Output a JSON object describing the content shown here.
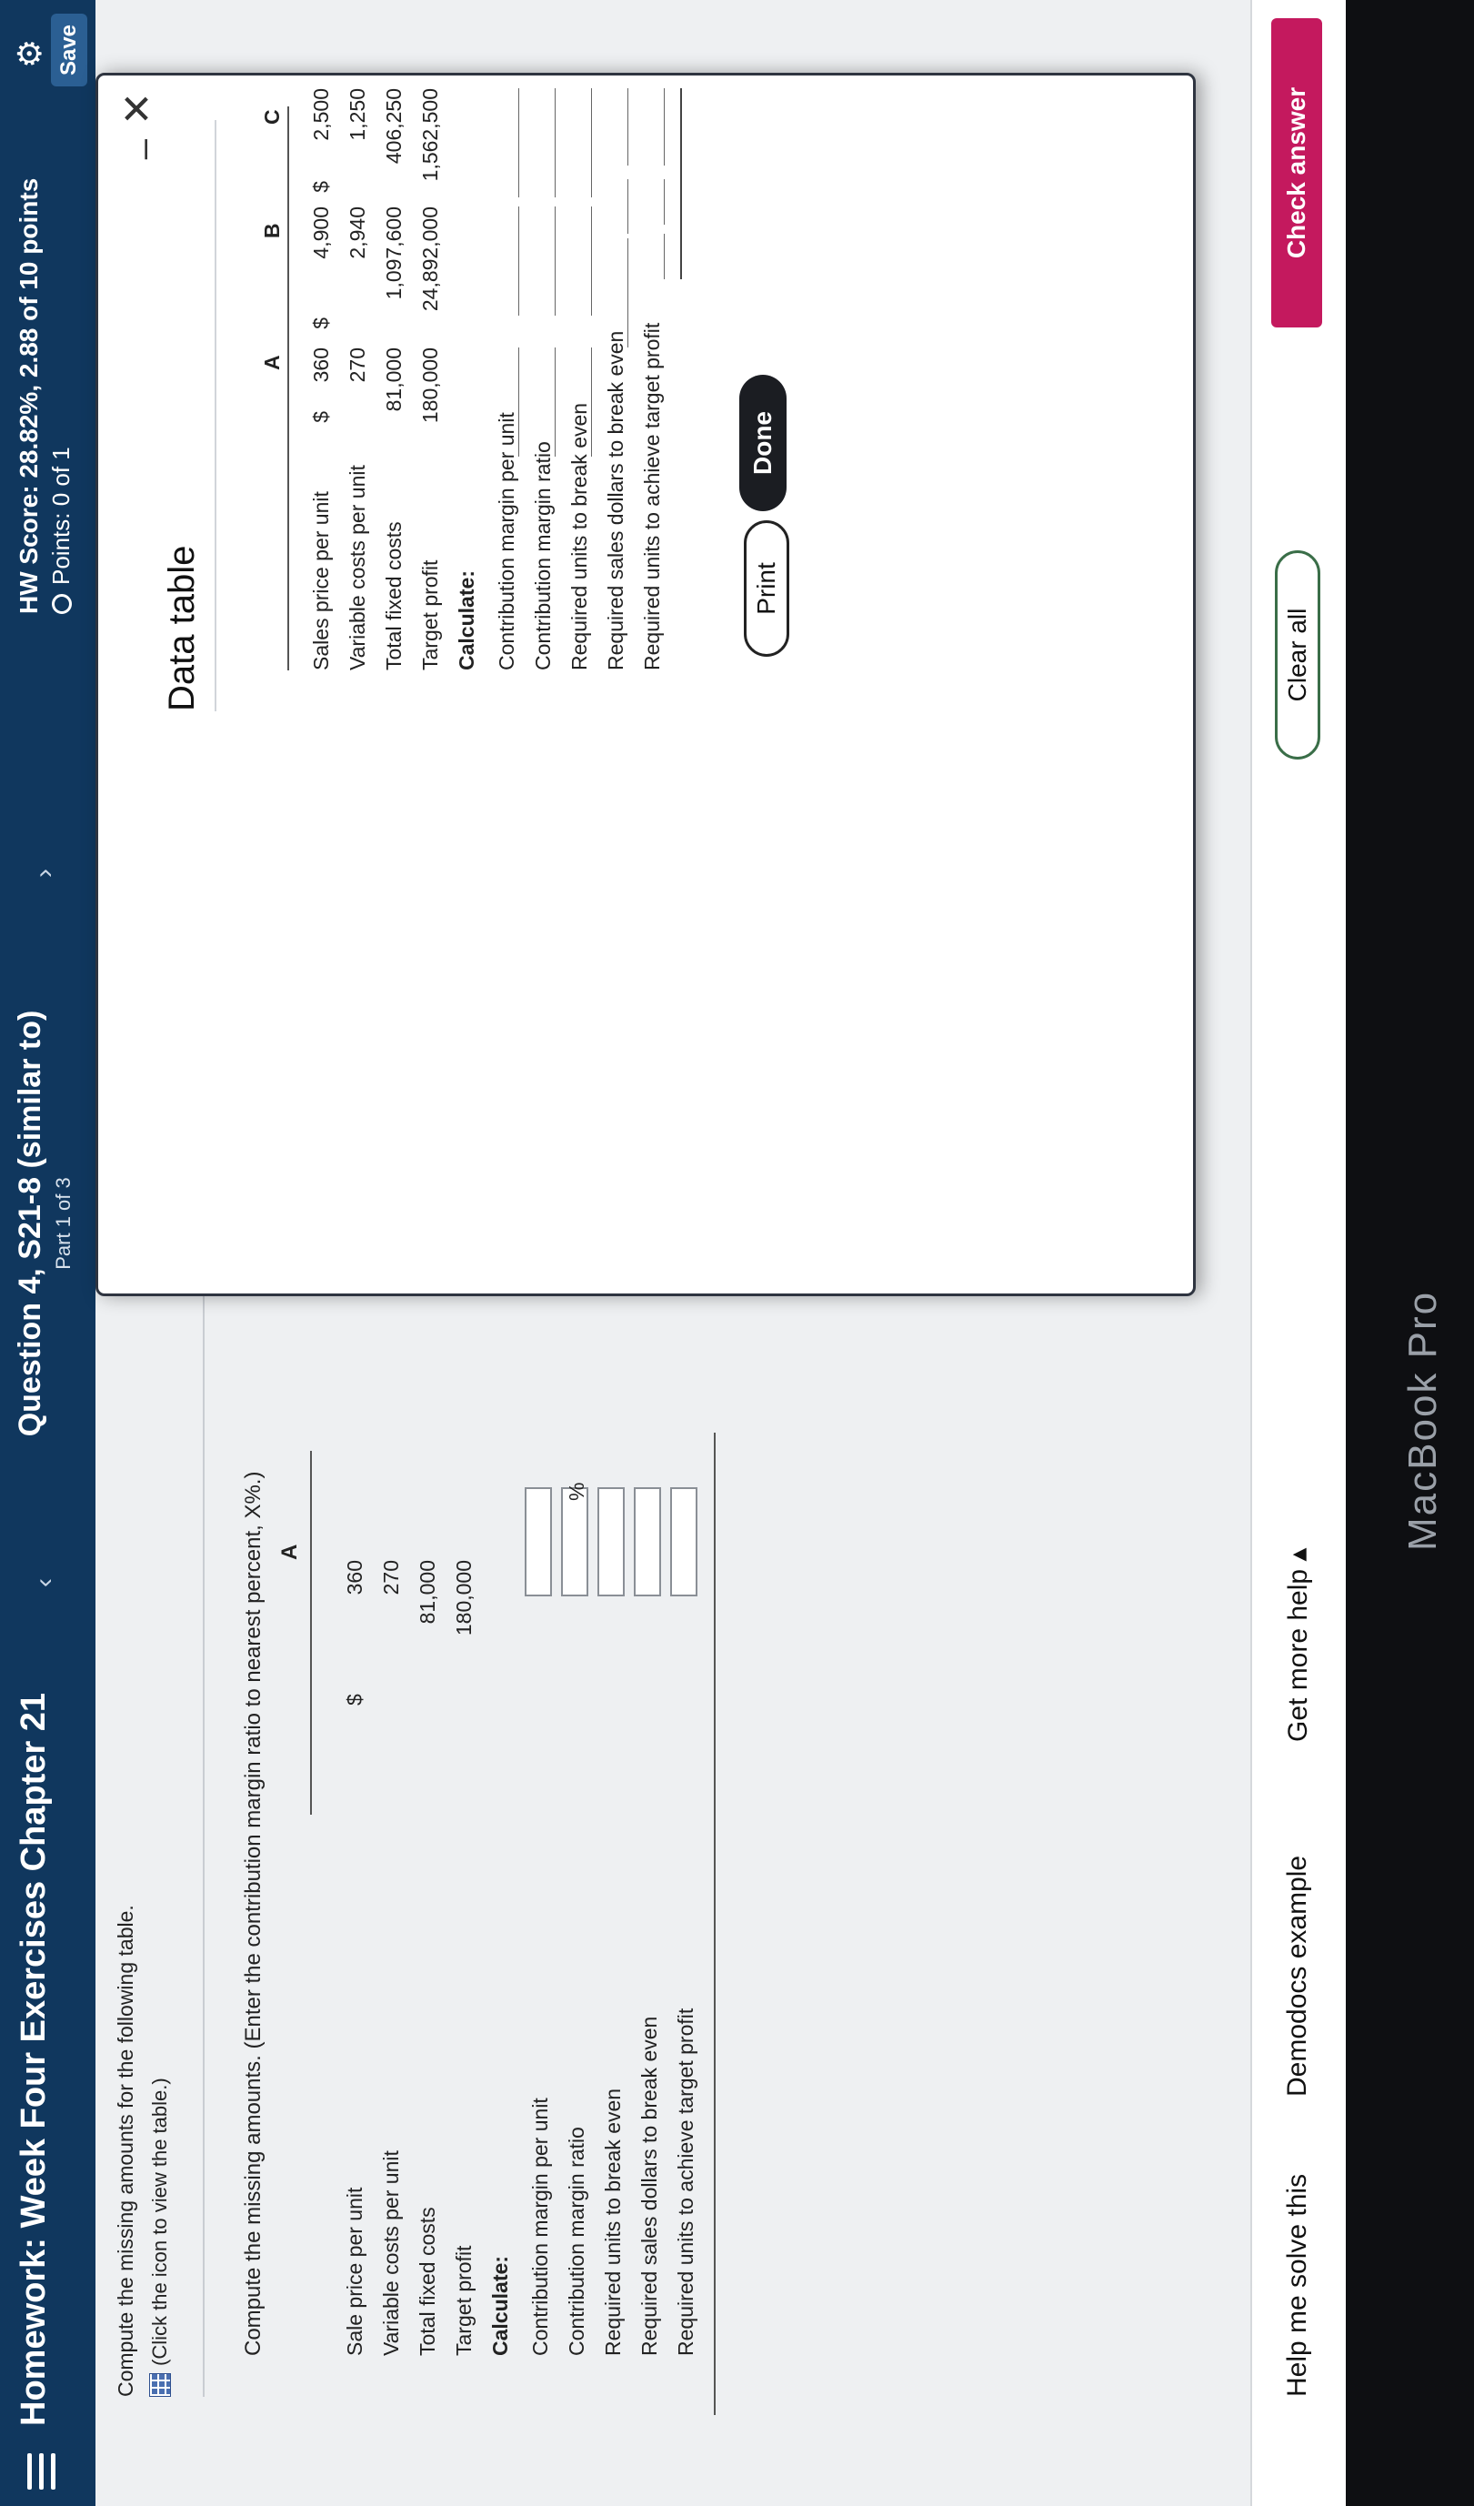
{
  "header": {
    "hw_title": "Homework: Week Four Exercises Chapter 21",
    "question_title": "Question 4, S21-8 (similar to)",
    "part": "Part 1 of 3",
    "prev_glyph": "‹",
    "next_glyph": "›",
    "hw_score": "HW Score: 28.82%, 2.88 of 10 points",
    "points": "Points: 0 of 1",
    "save_label": "Save",
    "gear_glyph": "⚙"
  },
  "main": {
    "instruction": "Compute the missing amounts for the following table.",
    "table_link": "(Click the icon to view the table.)",
    "compute_line": "Compute the missing amounts. (Enter the contribution margin ratio to nearest percent, X%.)",
    "column_header": "A",
    "dollar_sign": "$",
    "pct_sign": "%",
    "rows": [
      {
        "label": "Sale price per unit",
        "value": "360"
      },
      {
        "label": "Variable costs per unit",
        "value": "270"
      },
      {
        "label": "Total fixed costs",
        "value": "81,000"
      },
      {
        "label": "Target profit",
        "value": "180,000"
      },
      {
        "label": "Calculate:",
        "value": ""
      },
      {
        "label": "Contribution margin per unit",
        "value": ""
      },
      {
        "label": "Contribution margin ratio",
        "value": ""
      },
      {
        "label": "Required units to break even",
        "value": ""
      },
      {
        "label": "Required sales dollars to break even",
        "value": ""
      },
      {
        "label": "Required units to achieve target profit",
        "value": ""
      }
    ]
  },
  "modal": {
    "title": "Data table",
    "minimize_glyph": "–",
    "close_glyph": "✕",
    "columns": [
      "A",
      "B",
      "C"
    ],
    "dollar_sign": "$",
    "rows": [
      {
        "label": "Sales price per unit",
        "a": "360",
        "b": "4,900",
        "c": "2,500"
      },
      {
        "label": "Variable costs per unit",
        "a": "270",
        "b": "2,940",
        "c": "1,250"
      },
      {
        "label": "Total fixed costs",
        "a": "81,000",
        "b": "1,097,600",
        "c": "406,250"
      },
      {
        "label": "Target profit",
        "a": "180,000",
        "b": "24,892,000",
        "c": "1,562,500"
      },
      {
        "label": "Calculate:",
        "a": "",
        "b": "",
        "c": ""
      },
      {
        "label": "Contribution margin per unit",
        "a": "",
        "b": "",
        "c": ""
      },
      {
        "label": "Contribution margin ratio",
        "a": "",
        "b": "",
        "c": ""
      },
      {
        "label": "Required units to break even",
        "a": "",
        "b": "",
        "c": ""
      },
      {
        "label": "Required sales dollars to break even",
        "a": "",
        "b": "",
        "c": ""
      },
      {
        "label": "Required units to achieve target profit",
        "a": "",
        "b": "",
        "c": ""
      }
    ],
    "print_label": "Print",
    "done_label": "Done"
  },
  "footer": {
    "help_solve": "Help me solve this",
    "demodocs": "Demodocs example",
    "more_help": "Get more help ▴",
    "clear_all": "Clear all",
    "check_answer": "Check answer"
  },
  "device": {
    "label": "MacBook Pro"
  }
}
